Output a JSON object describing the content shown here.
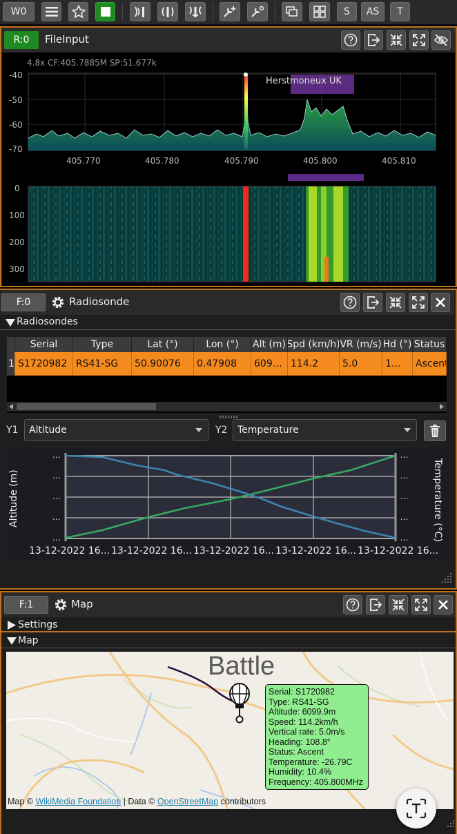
{
  "toolbar": {
    "workspace": "W0",
    "s_label": "S",
    "as_label": "AS",
    "t_label": "T"
  },
  "file_input": {
    "badge": "R:0",
    "title": "FileInput",
    "info": "4.8x CF:405.7885M SP:51.677k",
    "marker_label": "Herstmoneux UK",
    "y_ticks": [
      "-40",
      "-50",
      "-60",
      "-70"
    ],
    "x_ticks": [
      "405.770",
      "405.780",
      "405.790",
      "405.800",
      "405.810"
    ],
    "wf_ticks": [
      "0",
      "100",
      "200",
      "300"
    ]
  },
  "radiosonde": {
    "badge": "F:0",
    "title": "Radiosonde",
    "section": "Radiosondes",
    "columns": [
      "Serial",
      "Type",
      "Lat (°)",
      "Lon (°)",
      "Alt (m)",
      "Spd (km/h)",
      "VR (m/s)",
      "Hd (°)",
      "Status"
    ],
    "rows": [
      {
        "index": "1",
        "cells": [
          "S1720982",
          "RS41-SG",
          "50.90076",
          "0.47908",
          "609…",
          "114.2",
          "5.0",
          "1…",
          "Ascent"
        ]
      }
    ],
    "y1_label": "Y1",
    "y1_value": "Altitude",
    "y2_label": "Y2",
    "y2_value": "Temperature",
    "chart": {
      "y_left_label": "Altitude (m)",
      "y_right_label": "Temperature (°C)",
      "tick_ellipsis": "...",
      "x_ticks": [
        "13-12-2022 16...",
        "13-12-2022 16...",
        "13-12-2022 16...",
        "13-12-2022 16...",
        "13-12-2022 16..."
      ]
    }
  },
  "map": {
    "badge": "F:1",
    "title": "Map",
    "settings_label": "Settings",
    "map_label": "Map",
    "place_name": "Battle",
    "popup_lines": [
      "Serial: S1720982",
      "Type: RS41-SG",
      "Altitude: 6099.9m",
      "Speed: 114.2km/h",
      "Vertical rate: 5.0m/s",
      "Heading: 108.8°",
      "Status: Ascent",
      "Temperature: -26.79C",
      "Humidity: 10.4%",
      "Frequency: 405.800MHz"
    ],
    "attribution": {
      "prefix": "Map © ",
      "link1": "WikiMedia Foundation",
      "mid": " | Data © ",
      "link2": "OpenStreetMap",
      "suffix": " contributors"
    }
  },
  "colors": {
    "accent": "#c2721c",
    "badge_green": "#1f8a1f",
    "row_orange": "#f58a1f",
    "altitude_line": "#3c84b0",
    "temperature_line": "#37a860",
    "popup": "#90ee90"
  }
}
